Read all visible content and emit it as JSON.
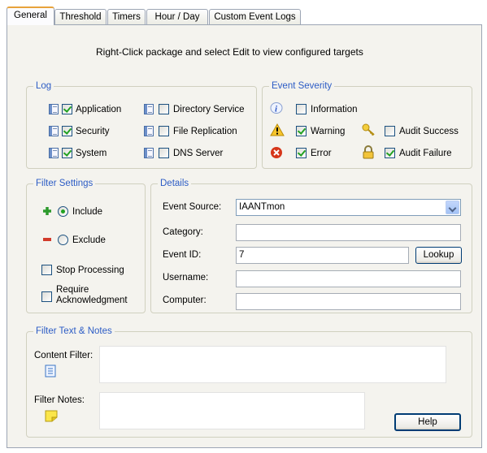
{
  "tabs": [
    "General",
    "Threshold",
    "Timers",
    "Hour / Day",
    "Custom Event Logs"
  ],
  "instruction": "Right-Click package and select Edit to view configured targets",
  "log": {
    "legend": "Log",
    "application": "Application",
    "security": "Security",
    "system": "System",
    "directory_service": "Directory Service",
    "file_replication": "File Replication",
    "dns_server": "DNS Server"
  },
  "severity": {
    "legend": "Event Severity",
    "information": "Information",
    "warning": "Warning",
    "error": "Error",
    "audit_success": "Audit Success",
    "audit_failure": "Audit Failure"
  },
  "filter": {
    "legend": "Filter Settings",
    "include": "Include",
    "exclude": "Exclude",
    "stop_processing": "Stop Processing",
    "require_ack": "Require Acknowledgment"
  },
  "details": {
    "legend": "Details",
    "event_source_label": "Event Source:",
    "event_source_value": "IAANTmon",
    "category_label": "Category:",
    "category_value": "",
    "event_id_label": "Event ID:",
    "event_id_value": "7",
    "lookup": "Lookup",
    "username_label": "Username:",
    "username_value": "",
    "computer_label": "Computer:",
    "computer_value": ""
  },
  "notes": {
    "legend": "Filter Text & Notes",
    "content_filter_label": "Content Filter:",
    "content_filter_value": "",
    "filter_notes_label": "Filter Notes:",
    "filter_notes_value": "",
    "help": "Help"
  }
}
